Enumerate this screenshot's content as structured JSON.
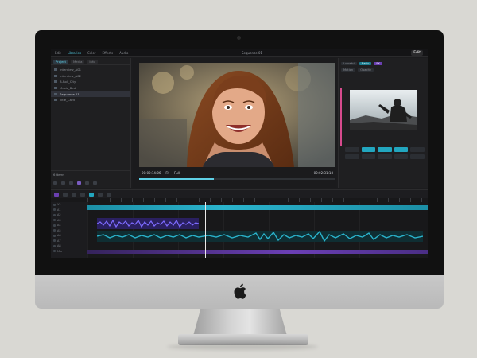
{
  "menubar": {
    "items": [
      "Edit",
      "Libraries",
      "Color",
      "Effects",
      "Audio"
    ],
    "active_index": 1,
    "title": "Sequence 01",
    "badge": "Edit"
  },
  "project_panel": {
    "tabs": [
      "Project",
      "Media",
      "Info"
    ],
    "assets": [
      "Interview_A01",
      "Interview_A02",
      "B-Roll_City",
      "Music_Bed",
      "Sequence 01",
      "Title_Card"
    ],
    "selected_index": 4,
    "footer_label": "6 items"
  },
  "program_monitor": {
    "timecode_current": "00:00:14:06",
    "timecode_duration": "00:02:31:18",
    "fit": "Fit",
    "quality": "Full"
  },
  "right_panel": {
    "row1": [
      "Lumetri",
      "Basic",
      "FX"
    ],
    "row2": [
      "Motion",
      "Opacity"
    ]
  },
  "timeline": {
    "tracks": [
      "V1",
      "A1",
      "A2",
      "A3",
      "A4",
      "A5",
      "A6",
      "A7",
      "A8",
      "Mix"
    ]
  },
  "colors": {
    "accent_cyan": "#22a6bf",
    "accent_purple": "#6a3fb0",
    "accent_pink": "#d64a8d"
  }
}
